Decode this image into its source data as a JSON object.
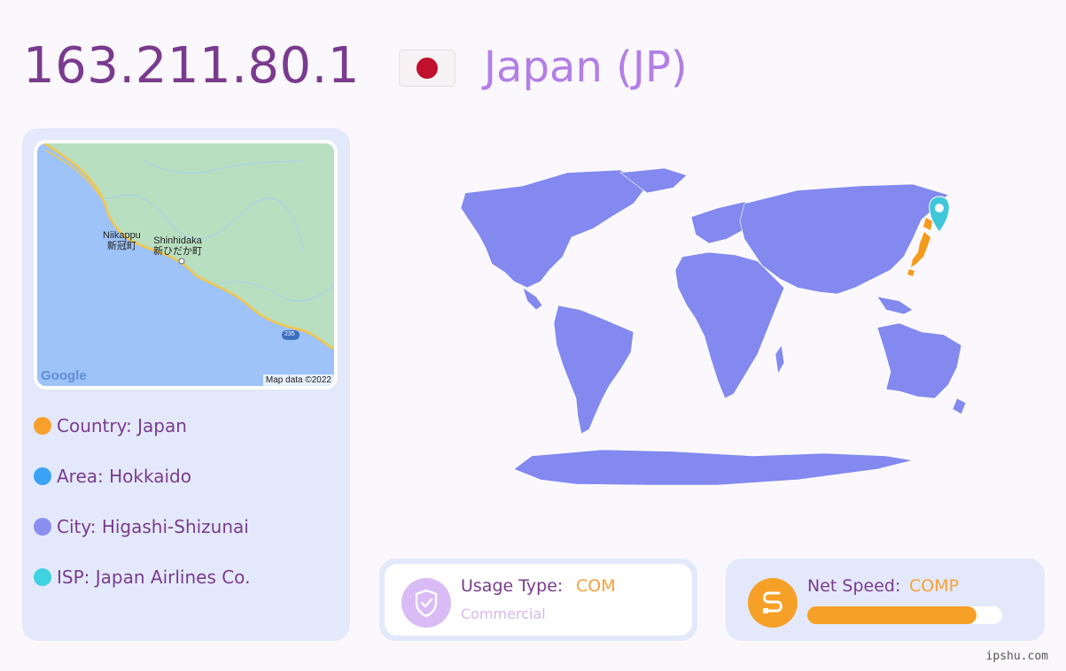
{
  "header": {
    "ip": "163.211.80.1",
    "country_title": "Japan (JP)",
    "flag_icon": "japan-flag-icon"
  },
  "map": {
    "labels": {
      "niikappu_en": "Niikappu",
      "niikappu_jp": "新冠町",
      "shinhidaka_en": "Shinhidaka",
      "shinhidaka_jp": "新ひだか町",
      "route": "235"
    },
    "logo": "Google",
    "attribution": "Map data ©2022"
  },
  "info": {
    "country": "Country: Japan",
    "area": "Area: Hokkaido",
    "city": "City: Higashi-Shizunai",
    "isp": "ISP: Japan Airlines Co."
  },
  "colors": {
    "country_dot": "#f9a02c",
    "area_dot": "#3aa3f6",
    "city_dot": "#8b8ff0",
    "isp_dot": "#3fd2e0",
    "world_land": "#8389ef",
    "highlight": "#f59a1b",
    "pin": "#3ec6d9"
  },
  "usage": {
    "label": "Usage Type:",
    "value": "COM",
    "description": "Commercial",
    "icon": "shield-check-icon"
  },
  "speed": {
    "label": "Net Speed:",
    "value": "COMP",
    "icon": "speed-route-icon",
    "level": 0.87
  },
  "footer": {
    "site": "ipshu.com"
  }
}
